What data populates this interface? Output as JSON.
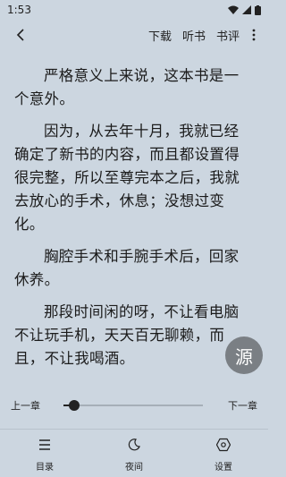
{
  "status_bar": {
    "time": "1:53",
    "icons": [
      "wifi-icon",
      "signal-icon",
      "battery-icon"
    ]
  },
  "toolbar": {
    "back_icon": "chevron-left-icon",
    "actions": [
      "下载",
      "听书",
      "书评"
    ],
    "more_icon": "more-vertical-icon"
  },
  "reader": {
    "paragraphs": [
      "严格意义上来说，这本书是一个意外。",
      "因为，从去年十月，我就已经确定了新书的内容，而且都设置得很完整，所以至尊完本之后，我就去放心的手术，休息；没想过变化。",
      "胸腔手术和手腕手术后，回家休养。",
      "那段时间闲的呀，不让看电脑不让玩手机，天天百无聊赖，而且，不让我喝酒。"
    ]
  },
  "source_button": {
    "label": "源"
  },
  "chapter_nav": {
    "prev": "上一章",
    "next": "下一章",
    "progress": 0.08
  },
  "bottom_nav": [
    {
      "label": "目录",
      "icon": "list-icon"
    },
    {
      "label": "夜间",
      "icon": "moon-icon"
    },
    {
      "label": "设置",
      "icon": "settings-icon"
    }
  ],
  "colors": {
    "background": "#ccd6e0",
    "text": "#1b1b1b",
    "source_button": "#7a7f84"
  }
}
